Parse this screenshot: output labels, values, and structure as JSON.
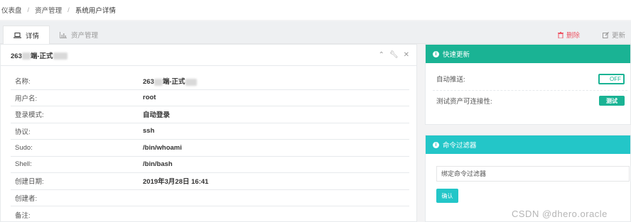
{
  "breadcrumb": {
    "items": [
      "仪表盘",
      "资产管理",
      "系统用户详情"
    ],
    "separator": "/"
  },
  "tabs": {
    "detail": "详情",
    "asset_manage": "资产管理",
    "delete": "删除",
    "update": "更新"
  },
  "detail_panel": {
    "title": "263",
    "title_suffix": "端-正式",
    "rows": [
      {
        "key": "名称:",
        "value": "263",
        "value_suffix": "端-正式"
      },
      {
        "key": "用户名:",
        "value": "root"
      },
      {
        "key": "登录模式:",
        "value": "自动登录"
      },
      {
        "key": "协议:",
        "value": "ssh"
      },
      {
        "key": "Sudo:",
        "value": "/bin/whoami"
      },
      {
        "key": "Shell:",
        "value": "/bin/bash"
      },
      {
        "key": "创建日期:",
        "value": "2019年3月28日 16:41"
      },
      {
        "key": "创建者:",
        "value": ""
      },
      {
        "key": "备注:",
        "value": ""
      }
    ]
  },
  "quick_update": {
    "title": "快速更新",
    "auto_push_label": "自动推送:",
    "auto_push_state": "OFF",
    "test_label": "测试资产可连接性:",
    "test_button": "测试"
  },
  "command_filter": {
    "title": "命令过滤器",
    "placeholder": "绑定命令过滤器",
    "confirm_button": "确认"
  },
  "watermark": "CSDN @dhero.oracle",
  "colors": {
    "primary_green": "#1ab394",
    "cyan": "#23c6c8",
    "danger": "#ed5565"
  }
}
